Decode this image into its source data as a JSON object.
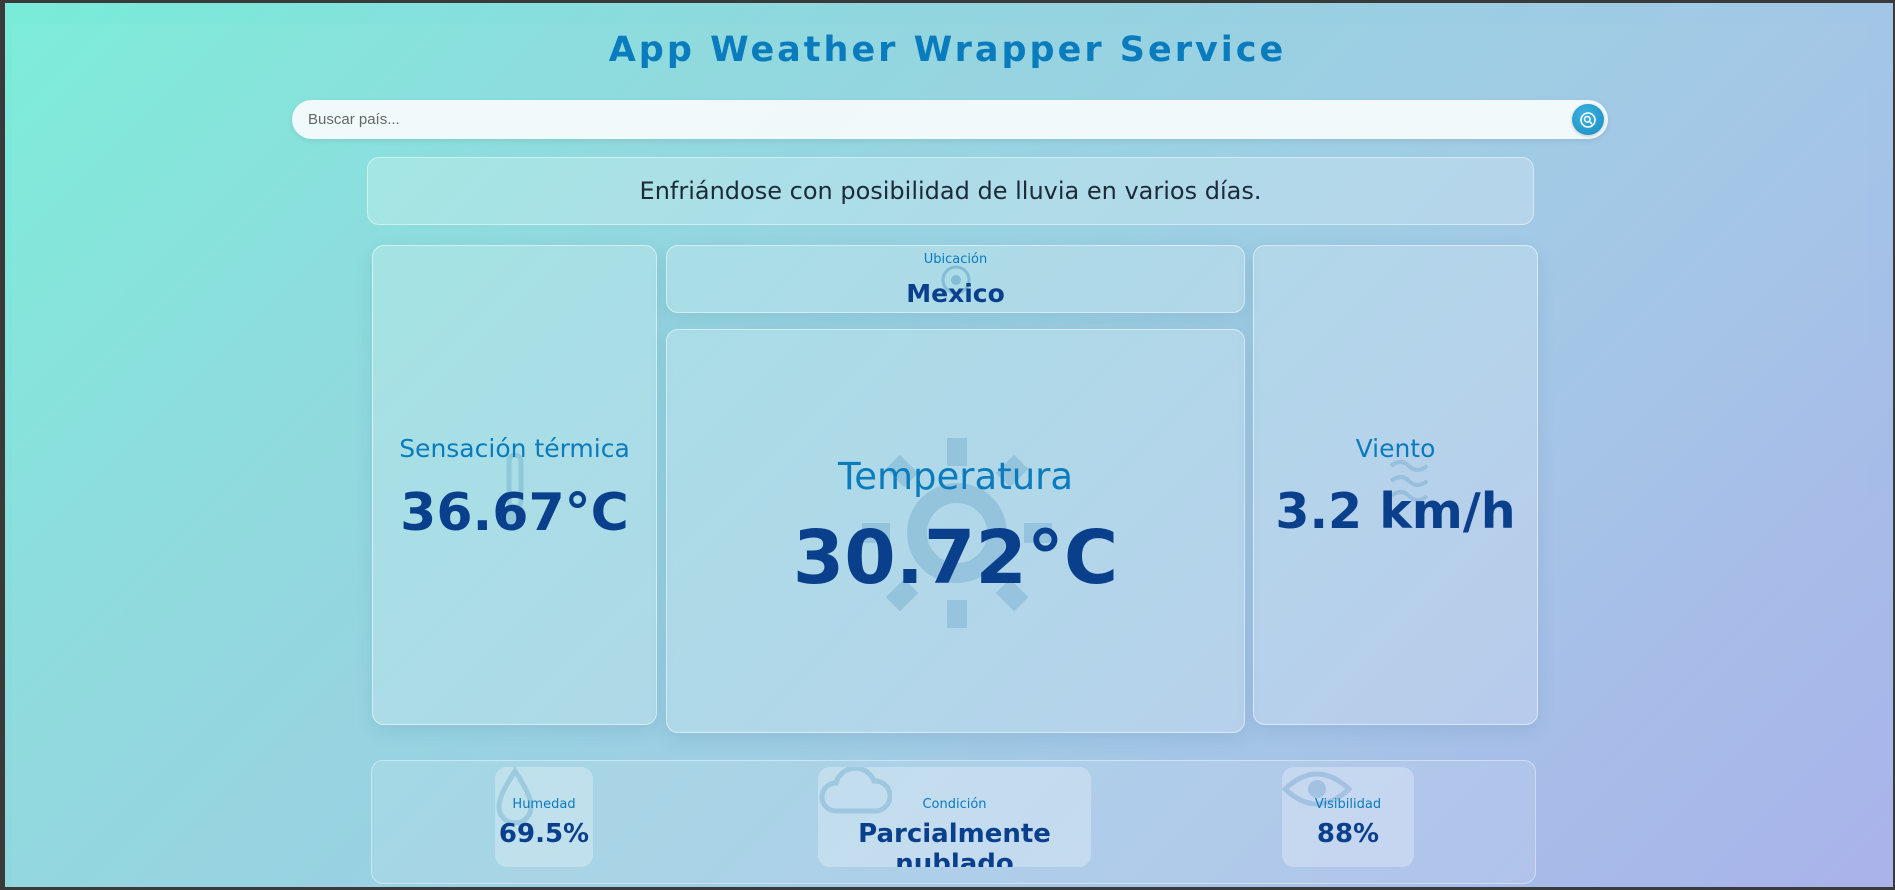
{
  "header": {
    "title": "App Weather Wrapper Service"
  },
  "search": {
    "placeholder": "Buscar país..."
  },
  "forecast": {
    "summary": "Enfriándose con posibilidad de lluvia en varios días."
  },
  "location": {
    "label": "Ubicación",
    "value": "Mexico"
  },
  "feels_like": {
    "label": "Sensación térmica",
    "value": "36.67°C"
  },
  "temperature": {
    "label": "Temperatura",
    "value": "30.72°C"
  },
  "wind": {
    "label": "Viento",
    "value": "3.2 km/h"
  },
  "humidity": {
    "label": "Humedad",
    "value": "69.5%"
  },
  "condition": {
    "label": "Condición",
    "value": "Parcialmente nublado"
  },
  "visibility": {
    "label": "Visibilidad",
    "value": "88%"
  },
  "icons": {
    "search": "search-icon",
    "location": "location-pin-icon",
    "thermometer": "thermometer-icon",
    "sun": "sun-icon",
    "wind": "wind-icon",
    "humidity": "droplet-icon",
    "cloud": "cloud-icon",
    "eye": "eye-icon"
  },
  "colors": {
    "accent": "#0a7bbd",
    "value": "#0a3f8c"
  }
}
